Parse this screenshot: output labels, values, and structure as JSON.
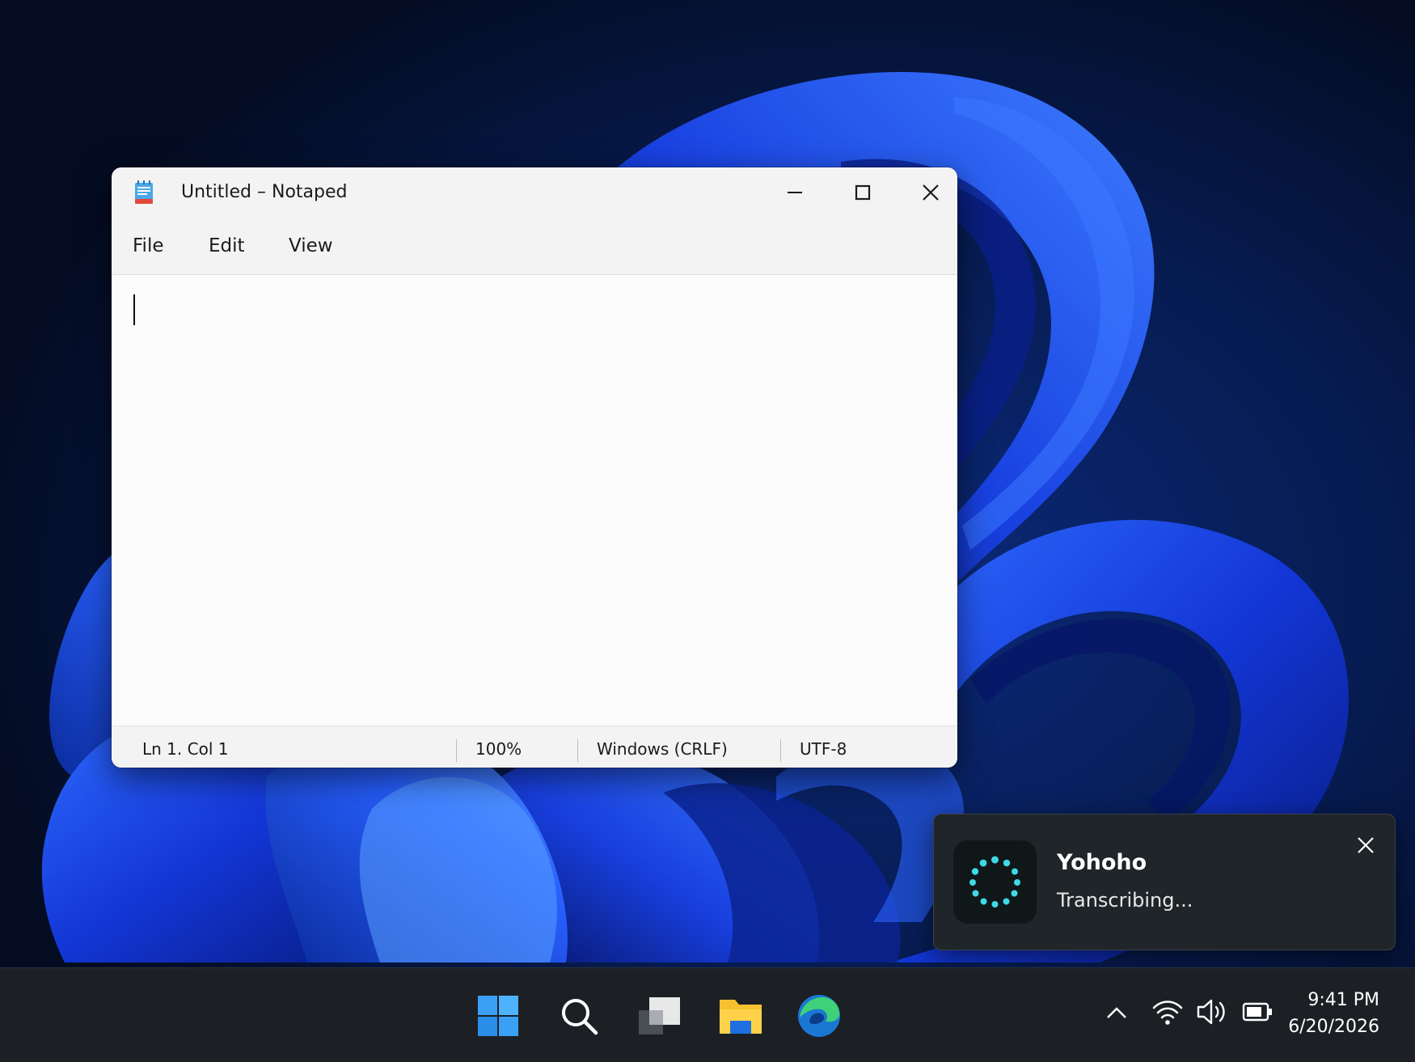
{
  "colors": {
    "wallpaper_dark": "#07112a",
    "wallpaper_blue": "#1a44e0",
    "window_bg": "#f3f3f3",
    "editor_bg": "#fbfbfb",
    "toast_bg": "#1f2529",
    "toast_accent": "#3fd9e6",
    "taskbar_bg": "#1c2024"
  },
  "notepad": {
    "title": "Untitled – Notaped",
    "icon": "notepad-icon",
    "menu": {
      "file": "File",
      "edit": "Edit",
      "view": "View"
    },
    "editor_text": "",
    "status": {
      "position": "Ln 1. Col 1",
      "zoom": "100%",
      "line_ending": "Windows (CRLF)",
      "encoding": "UTF-8"
    }
  },
  "toast": {
    "app_name": "Yohoho",
    "message": "Transcribing...",
    "icon": "loading-spinner-icon"
  },
  "taskbar": {
    "pinned": [
      "start-icon",
      "search-icon",
      "task-view-icon",
      "file-explorer-icon",
      "edge-icon"
    ],
    "tray": [
      "chevron-up-icon",
      "wifi-icon",
      "volume-icon",
      "battery-icon"
    ],
    "time": "9:41 PM",
    "date": "6/20/2026"
  }
}
